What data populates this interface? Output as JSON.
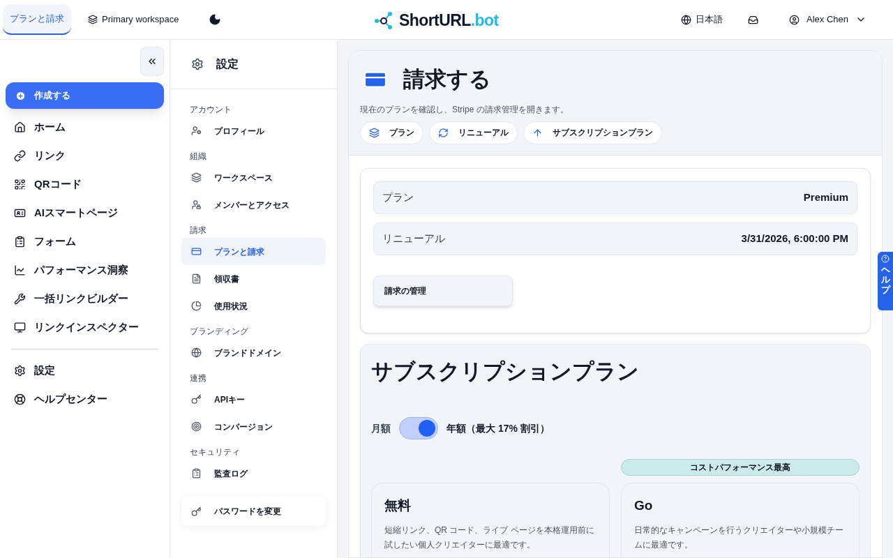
{
  "header": {
    "tabs": [
      {
        "label": "プランと請求",
        "selected": true
      },
      {
        "label": "Primary workspace",
        "selected": false
      }
    ],
    "logo": {
      "name": "ShortURL",
      "tld": ".bot"
    },
    "language": "日本語",
    "user": "Alex Chen"
  },
  "sidebar": {
    "create": "作成する",
    "items": [
      "ホーム",
      "リンク",
      "QRコード",
      "AIスマートページ",
      "フォーム",
      "パフォーマンス洞察",
      "一括リンクビルダー",
      "リンクインスペクター"
    ],
    "footer_items": [
      "設定",
      "ヘルプセンター"
    ]
  },
  "settings_nav": {
    "title": "設定",
    "sections": [
      {
        "heading": "アカウント",
        "items": [
          {
            "label": "プロフィール",
            "selected": false
          }
        ]
      },
      {
        "heading": "組織",
        "items": [
          {
            "label": "ワークスペース",
            "selected": false
          },
          {
            "label": "メンバーとアクセス",
            "selected": false
          }
        ]
      },
      {
        "heading": "請求",
        "items": [
          {
            "label": "プランと請求",
            "selected": true
          },
          {
            "label": "領収書",
            "selected": false
          },
          {
            "label": "使用状況",
            "selected": false
          }
        ]
      },
      {
        "heading": "ブランディング",
        "items": [
          {
            "label": "ブランドドメイン",
            "selected": false
          }
        ]
      },
      {
        "heading": "連携",
        "items": [
          {
            "label": "APIキー",
            "selected": false
          },
          {
            "label": "コンバージョン",
            "selected": false
          }
        ]
      },
      {
        "heading": "セキュリティ",
        "items": [
          {
            "label": "監査ログ",
            "selected": false
          }
        ]
      }
    ],
    "footer": "パスワードを変更"
  },
  "billing": {
    "title": "請求する",
    "subtitle": "現在のプランを確認し、Stripe の請求管理を開きます。",
    "chips": [
      "プラン",
      "リニューアル",
      "サブスクリプションプラン"
    ],
    "details": [
      {
        "label": "プラン",
        "value": "Premium"
      },
      {
        "label": "リニューアル",
        "value": "3/31/2026, 6:00:00 PM"
      }
    ],
    "manage_button": "請求の管理"
  },
  "plans": {
    "title": "サブスクリプションプラン",
    "monthly_label": "月額",
    "annual_label": "年額（最大 17% 割引）",
    "annual": true,
    "cards": [
      {
        "name": "無料",
        "description": "短縮リンク、QR コード、ライブ ページを本格運用前に試したい個人クリエイターに最適です。"
      },
      {
        "name": "Go",
        "description": "日常的なキャンペーンを行うクリエイターや小規模チームに最適です。",
        "badge": "コストパフォーマンス最高"
      }
    ]
  },
  "help_tab": "ヘルプ"
}
